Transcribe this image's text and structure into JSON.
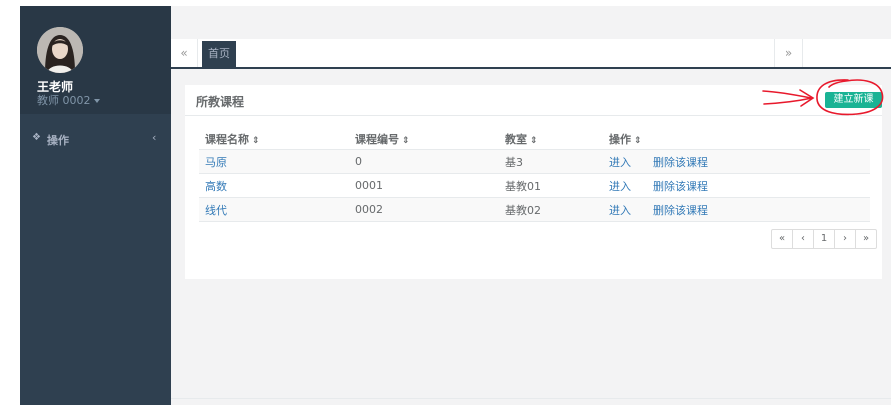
{
  "sidebar": {
    "user_name": "王老师",
    "user_role": "教师 0002",
    "nav_item_label": "操作"
  },
  "tabs": {
    "prev_label": "«",
    "home_label": "首页",
    "next_label": "»"
  },
  "panel": {
    "title": "所教课程",
    "create_button_label": "建立新课程",
    "columns": [
      {
        "label": "课程名称",
        "sort_icon": "sort-icon"
      },
      {
        "label": "课程编号",
        "sort_icon": "sort-icon"
      },
      {
        "label": "教室",
        "sort_icon": "sort-icon"
      },
      {
        "label": "操作",
        "sort_icon": "sort-icon"
      }
    ],
    "rows": [
      {
        "name": "马原",
        "code": "0",
        "room": "基3",
        "enter_label": "进入",
        "delete_label": "删除该课程"
      },
      {
        "name": "高数",
        "code": "0001",
        "room": "基教01",
        "enter_label": "进入",
        "delete_label": "删除该课程"
      },
      {
        "name": "线代",
        "code": "0002",
        "room": "基教02",
        "enter_label": "进入",
        "delete_label": "删除该课程"
      }
    ],
    "pagination": {
      "first": "«",
      "prev": "‹",
      "current": "1",
      "next": "›",
      "last": "»"
    }
  },
  "colors": {
    "sidebar_bg": "#2f4050",
    "accent_green": "#1ab394",
    "link_blue": "#337ab7",
    "annotation_red": "#e8192c"
  }
}
